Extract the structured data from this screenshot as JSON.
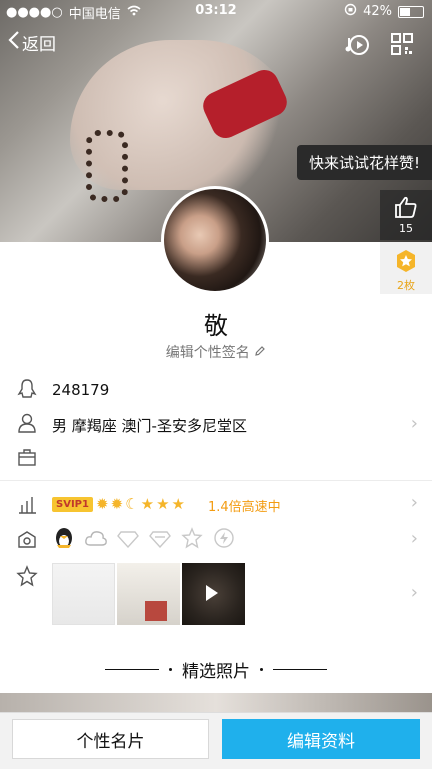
{
  "status": {
    "carrier": "中国电信",
    "time": "03:12",
    "battery": "42%",
    "battery_level": 0.42
  },
  "nav": {
    "back_label": "返回"
  },
  "cover": {
    "tip": "快来试试花样赞!",
    "like_count": "15",
    "badge_count": "2枚"
  },
  "profile": {
    "name": "敬",
    "signature": "编辑个性签名"
  },
  "info": {
    "qq": "248179",
    "details": "男 摩羯座 澳门-圣安多尼堂区"
  },
  "vip": {
    "tag": "SVIP1",
    "speed": "1.4倍高速中"
  },
  "section": {
    "title": "精选照片"
  },
  "buttons": {
    "card": "个性名片",
    "edit": "编辑资料"
  },
  "colors": {
    "accent": "#1fb0ec",
    "vip_orange": "#f39c12",
    "vip_tag": "#f7c430"
  }
}
